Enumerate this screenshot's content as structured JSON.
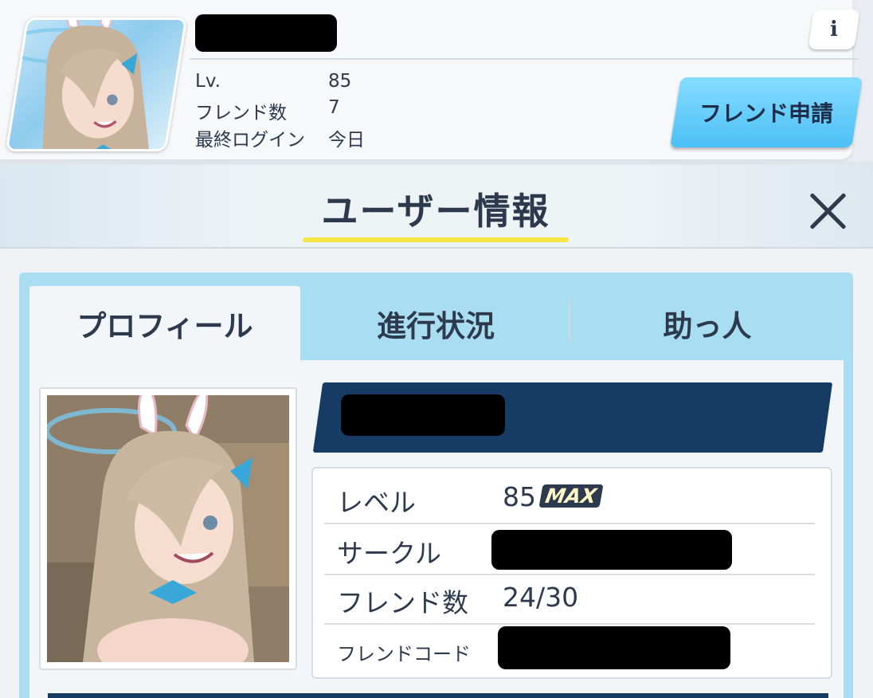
{
  "friend_card": {
    "stats": [
      {
        "label": "Lv.",
        "value": "85"
      },
      {
        "label": "フレンド数",
        "value": "7"
      },
      {
        "label": "最終ログイン",
        "value": "今日"
      }
    ],
    "info_button_label": "i",
    "friend_request_label": "フレンド申請"
  },
  "user_info": {
    "title": "ユーザー情報",
    "tabs": [
      "プロフィール",
      "進行状況",
      "助っ人"
    ],
    "active_tab": "プロフィール",
    "profile": {
      "level_label": "レベル",
      "level_value": "85",
      "level_badge": "MAX",
      "circle_label": "サークル",
      "friends_label": "フレンド数",
      "friends_value": "24/30",
      "friend_code_label": "フレンドコード"
    }
  },
  "colors": {
    "accent_blue": "#4cc0f6",
    "tab_bar": "#a9def2",
    "name_banner": "#163c66",
    "title_underline": "#f7e544"
  }
}
